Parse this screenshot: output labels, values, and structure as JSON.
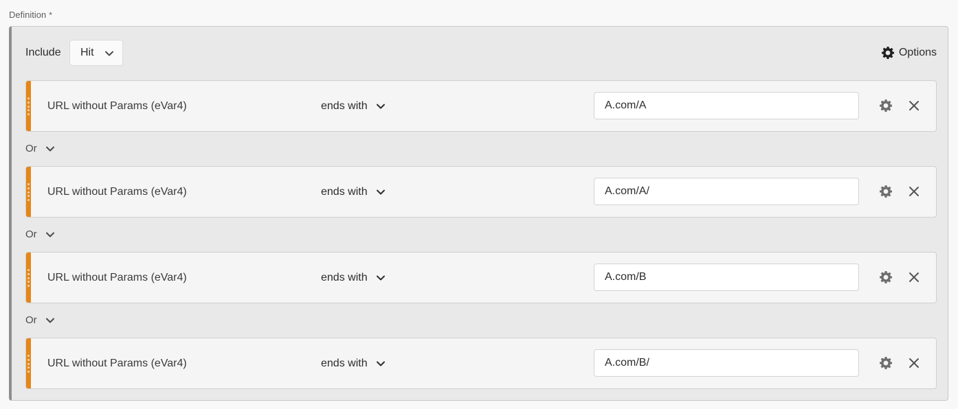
{
  "definition": {
    "label": "Definition",
    "required_mark": "*"
  },
  "header": {
    "include_label": "Include",
    "scope_value": "Hit",
    "options_label": "Options"
  },
  "rules": [
    {
      "dimension": "URL without Params (eVar4)",
      "operator": "ends with",
      "value": "A.com/A"
    },
    {
      "dimension": "URL without Params (eVar4)",
      "operator": "ends with",
      "value": "A.com/A/"
    },
    {
      "dimension": "URL without Params (eVar4)",
      "operator": "ends with",
      "value": "A.com/B"
    },
    {
      "dimension": "URL without Params (eVar4)",
      "operator": "ends with",
      "value": "A.com/B/"
    }
  ],
  "connectors": [
    {
      "label": "Or"
    },
    {
      "label": "Or"
    },
    {
      "label": "Or"
    }
  ],
  "colors": {
    "rule_accent": "#e68619",
    "container_bg": "#e9e9e9",
    "rule_bg": "#f5f5f5"
  }
}
